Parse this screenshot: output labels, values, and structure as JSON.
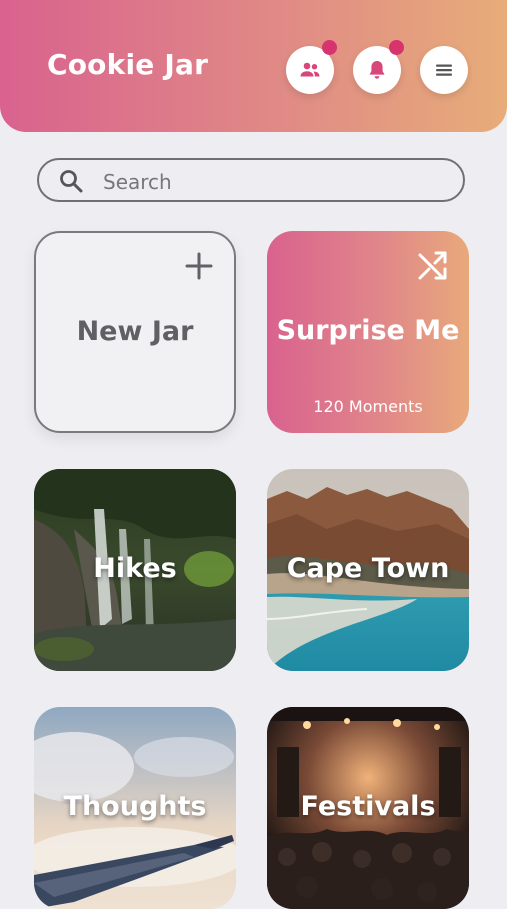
{
  "header": {
    "title": "Cookie Jar",
    "buttons": [
      {
        "icon": "people-icon",
        "has_notification": true
      },
      {
        "icon": "bell-icon",
        "has_notification": true
      },
      {
        "icon": "menu-icon",
        "has_notification": false
      }
    ]
  },
  "search": {
    "placeholder": "Search",
    "value": ""
  },
  "jars": {
    "new_jar": {
      "label": "New Jar",
      "icon": "plus-icon"
    },
    "surprise": {
      "label": "Surprise Me",
      "subtitle": "120 Moments",
      "icon": "shuffle-icon"
    },
    "hikes": {
      "label": "Hikes"
    },
    "cape_town": {
      "label": "Cape Town"
    },
    "thoughts": {
      "label": "Thoughts"
    },
    "festivals": {
      "label": "Festivals"
    }
  },
  "colors": {
    "accent_start": "#d9628e",
    "accent_end": "#e7ad79",
    "notification_dot": "#d6336f",
    "background": "#eeeef2"
  }
}
